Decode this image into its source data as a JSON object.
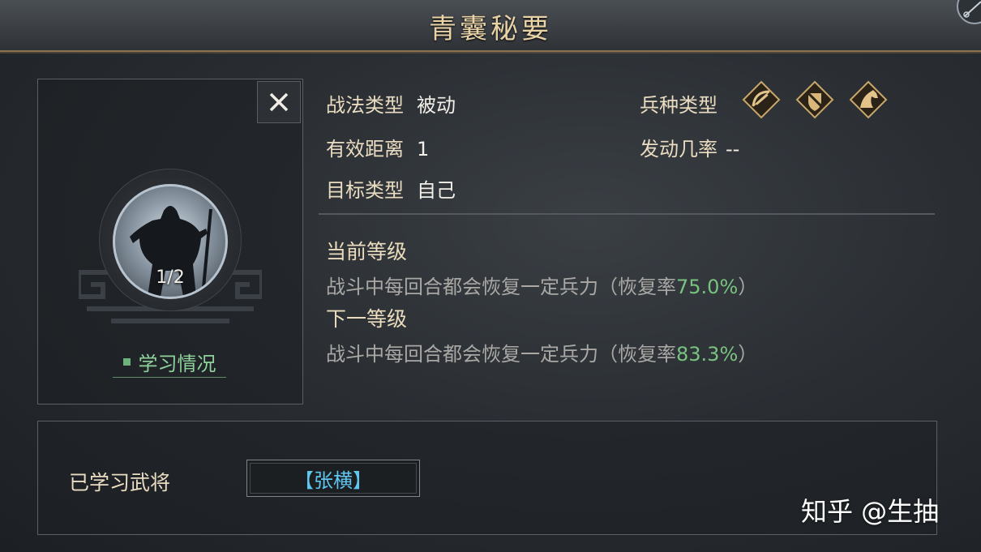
{
  "header": {
    "title": "青囊秘要"
  },
  "portrait": {
    "close_symbol": "✕",
    "level": "1/2",
    "study_label": "学习情况"
  },
  "attributes": {
    "tactic_type_key": "战法类型",
    "tactic_type_val": "被动",
    "range_key": "有效距离",
    "range_val": "1",
    "target_key": "目标类型",
    "target_val": "自己",
    "troop_type_key": "兵种类型",
    "troop_icons": [
      "bow-icon",
      "shield-icon",
      "horse-icon"
    ],
    "trigger_key": "发动几率",
    "trigger_val": "--"
  },
  "levels": {
    "current_head": "当前等级",
    "current_desc_prefix": "战斗中每回合都会恢复一定兵力（恢复率",
    "current_rate": "75.0%",
    "current_desc_suffix": "）",
    "next_head": "下一等级",
    "next_desc_prefix": "战斗中每回合都会恢复一定兵力（恢复率",
    "next_rate": "83.3%",
    "next_desc_suffix": "）"
  },
  "learned": {
    "label": "已学习武将",
    "general": "【张横】"
  },
  "watermark": "知乎 @生抽",
  "colors": {
    "accent_gold": "#e9d3a6",
    "rate_green": "#79c27f",
    "general_blue": "#5fc6f0",
    "study_green": "#8fd29b"
  }
}
